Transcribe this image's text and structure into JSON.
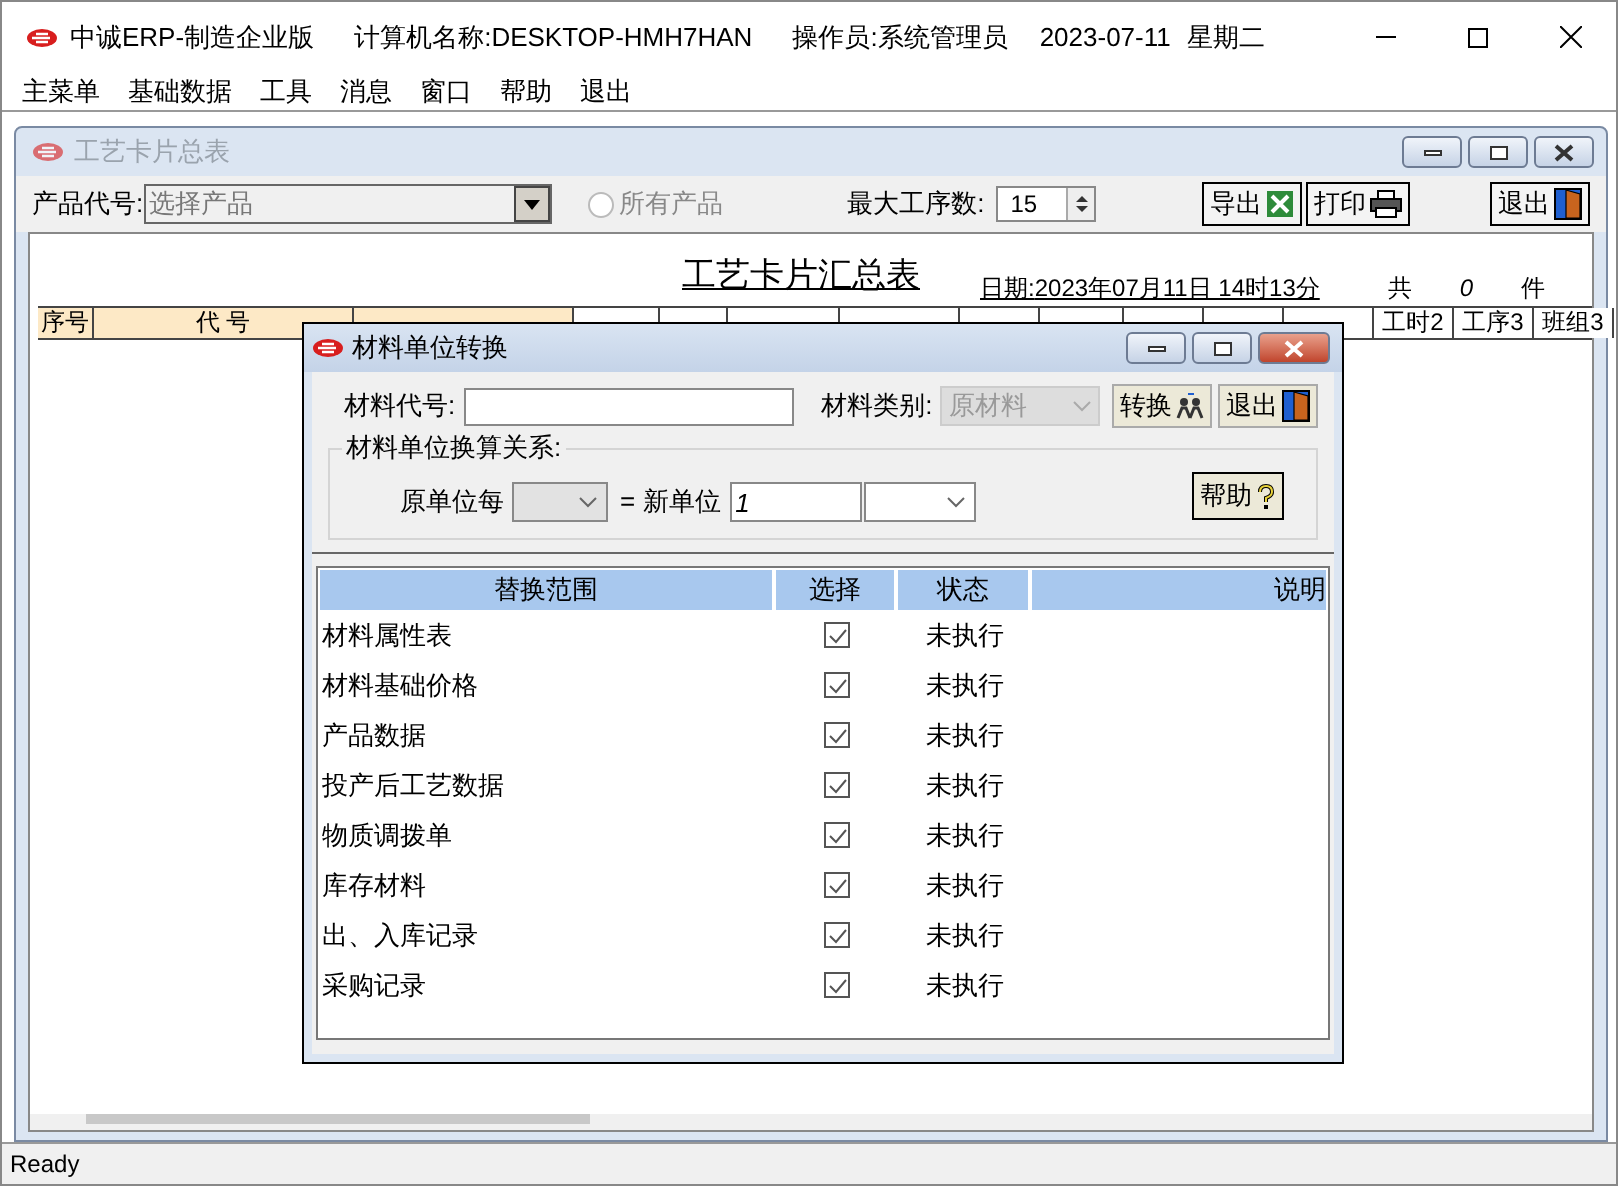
{
  "app": {
    "title": "中诚ERP-制造企业版",
    "computer_label": "计算机名称:",
    "computer_name": "DESKTOP-HMH7HAN",
    "operator_label": "操作员:",
    "operator": "系统管理员",
    "date": "2023-07-11",
    "weekday": "星期二"
  },
  "menu": [
    "主菜单",
    "基础数据",
    "工具",
    "消息",
    "窗口",
    "帮助",
    "退出"
  ],
  "child_window": {
    "title": "工艺卡片总表",
    "active": false,
    "product_code_label": "产品代号:",
    "product_placeholder": "选择产品",
    "all_products": {
      "label": "所有产品",
      "selected": false
    },
    "max_steps_label": "最大工序数:",
    "max_steps_value": "15",
    "buttons": [
      {
        "label": "导出",
        "kind": "export"
      },
      {
        "label": "打印",
        "kind": "print"
      },
      {
        "label": "退出",
        "kind": "exit"
      }
    ]
  },
  "report": {
    "title": "工艺卡片汇总表",
    "date_label": "日期:",
    "date": "2023年07月11日 14时13分",
    "count_label": "共",
    "count": "0",
    "unit": "件",
    "columns": [
      {
        "label": "序号",
        "highlight": true
      },
      {
        "label": "代 号",
        "highlight": true
      },
      {
        "highlight": true
      },
      {
        "highlight": false
      },
      {
        "highlight": false
      },
      {
        "highlight": false
      },
      {
        "highlight": false
      },
      {
        "highlight": false
      },
      {
        "highlight": false
      },
      {
        "highlight": false
      },
      {
        "highlight": false
      },
      {
        "highlight": false
      },
      {
        "label": "工时2",
        "highlight": false
      },
      {
        "label": "工序3",
        "highlight": false
      },
      {
        "label": "班组3",
        "highlight": false
      }
    ]
  },
  "dialog": {
    "title": "材料单位转换",
    "material_code_label": "材料代号:",
    "category_label": "材料类别:",
    "category": "原材料",
    "category_disabled": true,
    "buttons": [
      {
        "label": "转换",
        "kind": "convert"
      },
      {
        "label": "退出",
        "kind": "exit"
      }
    ],
    "group_label": "材料单位换算关系:",
    "original_unit_label": "原单位每",
    "equals": "=",
    "new_unit_label": "新单位",
    "new_unit_value": "1",
    "help": "帮助",
    "columns": [
      "替换范围",
      "选择",
      "状态",
      "说明"
    ],
    "rows": [
      {
        "scope": "材料属性表",
        "checked": true,
        "status": "未执行"
      },
      {
        "scope": "材料基础价格",
        "checked": true,
        "status": "未执行"
      },
      {
        "scope": "产品数据",
        "checked": true,
        "status": "未执行"
      },
      {
        "scope": "投产后工艺数据",
        "checked": true,
        "status": "未执行"
      },
      {
        "scope": "物质调拨单",
        "checked": true,
        "status": "未执行"
      },
      {
        "scope": "库存材料",
        "checked": true,
        "status": "未执行"
      },
      {
        "scope": "出、入库记录",
        "checked": true,
        "status": "未执行"
      },
      {
        "scope": "采购记录",
        "checked": true,
        "status": "未执行"
      }
    ]
  },
  "status_bar": "Ready"
}
